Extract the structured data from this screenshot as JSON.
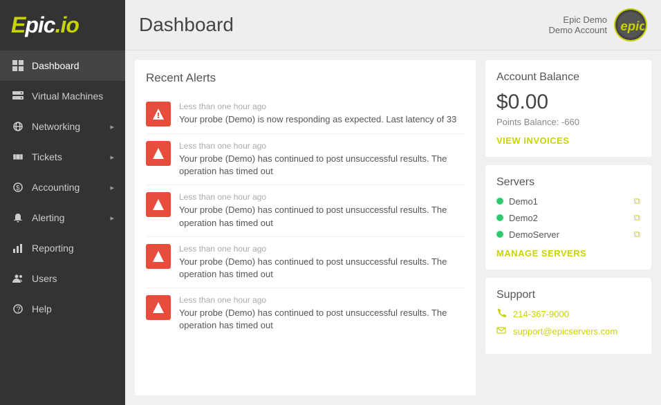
{
  "sidebar": {
    "logo": "epic.io",
    "items": [
      {
        "id": "dashboard",
        "label": "Dashboard",
        "icon": "grid",
        "active": true,
        "hasChevron": false
      },
      {
        "id": "virtual-machines",
        "label": "Virtual Machines",
        "icon": "server",
        "active": false,
        "hasChevron": false
      },
      {
        "id": "networking",
        "label": "Networking",
        "icon": "globe",
        "active": false,
        "hasChevron": true
      },
      {
        "id": "tickets",
        "label": "Tickets",
        "icon": "ticket",
        "active": false,
        "hasChevron": true
      },
      {
        "id": "accounting",
        "label": "Accounting",
        "icon": "dollar",
        "active": false,
        "hasChevron": true
      },
      {
        "id": "alerting",
        "label": "Alerting",
        "icon": "bell",
        "active": false,
        "hasChevron": true
      },
      {
        "id": "reporting",
        "label": "Reporting",
        "icon": "chart",
        "active": false,
        "hasChevron": false
      },
      {
        "id": "users",
        "label": "Users",
        "icon": "people",
        "active": false,
        "hasChevron": false
      },
      {
        "id": "help",
        "label": "Help",
        "icon": "question",
        "active": false,
        "hasChevron": false
      }
    ]
  },
  "header": {
    "title": "Dashboard",
    "user_name": "Epic Demo",
    "user_account": "Demo Account",
    "avatar_text": "epic"
  },
  "alerts": {
    "title": "Recent Alerts",
    "items": [
      {
        "time": "Less than one hour ago",
        "message": "Your probe (Demo) is now responding as expected. Last latency of 33"
      },
      {
        "time": "Less than one hour ago",
        "message": "Your probe (Demo) has continued to post unsuccessful results. The operation has timed out"
      },
      {
        "time": "Less than one hour ago",
        "message": "Your probe (Demo) has continued to post unsuccessful results. The operation has timed out"
      },
      {
        "time": "Less than one hour ago",
        "message": "Your probe (Demo) has continued to post unsuccessful results. The operation has timed out"
      },
      {
        "time": "Less than one hour ago",
        "message": "Your probe (Demo) has continued to post unsuccessful results. The operation has timed out"
      }
    ]
  },
  "account_balance": {
    "title": "Account Balance",
    "amount": "$0.00",
    "points_label": "Points Balance: -660",
    "view_invoices": "VIEW INVOICES"
  },
  "servers": {
    "title": "Servers",
    "items": [
      {
        "name": "Demo1",
        "status": "online"
      },
      {
        "name": "Demo2",
        "status": "online"
      },
      {
        "name": "DemoServer",
        "status": "online"
      }
    ],
    "manage_label": "MANAGE SERVERS"
  },
  "support": {
    "title": "Support",
    "phone": "214-367-9000",
    "email": "support@epicservers.com"
  }
}
